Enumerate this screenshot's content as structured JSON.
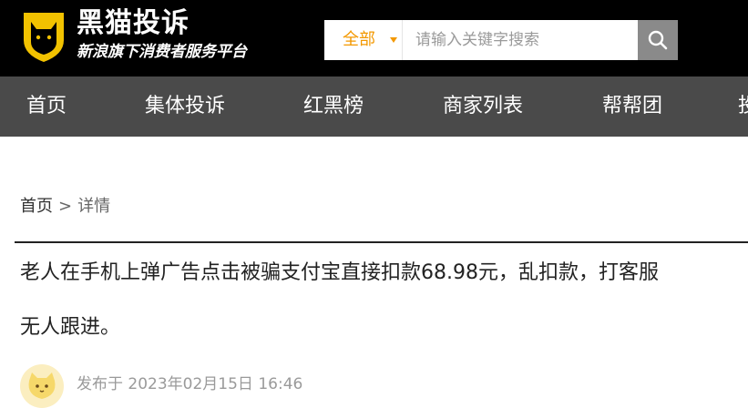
{
  "brand": {
    "title": "黑猫投诉",
    "subtitle": "新浪旗下消费者服务平台"
  },
  "search": {
    "scope_label": "全部",
    "placeholder": "请输入关键字搜索",
    "value": ""
  },
  "nav": {
    "items": [
      {
        "label": "首页"
      },
      {
        "label": "集体投诉"
      },
      {
        "label": "红黑榜"
      },
      {
        "label": "商家列表"
      },
      {
        "label": "帮帮团"
      },
      {
        "label": "投"
      }
    ]
  },
  "breadcrumb": {
    "home": "首页",
    "separator": ">",
    "current": "详情"
  },
  "complaint": {
    "title_line1": "老人在手机上弹广告点击被骗支付宝直接扣款68.98元，乱扣款，打客服",
    "title_line2": "无人跟进。",
    "meta": "发布于 2023年02月15日 16:46"
  },
  "colors": {
    "header_bg": "#000000",
    "nav_bg": "#4a4a4a",
    "accent": "#f39800",
    "search_button": "#8a8a8a",
    "logo_shield": "#f2c200"
  },
  "icons": {
    "logo": "cat-shield-icon",
    "search": "search-icon",
    "dropdown": "caret-down-icon",
    "avatar": "cat-avatar-icon"
  }
}
